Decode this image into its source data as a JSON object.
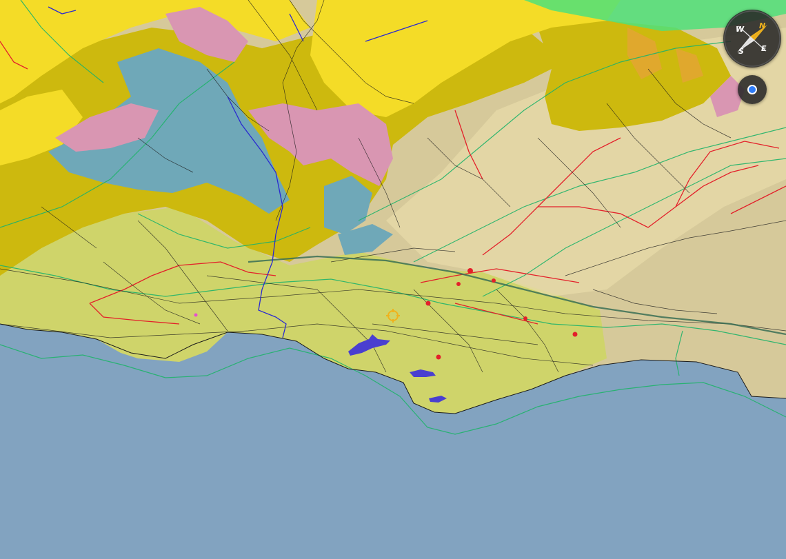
{
  "map": {
    "view": "3d-terrain",
    "layers": [
      "geologic-units",
      "faults",
      "roads",
      "contours",
      "water-bodies"
    ],
    "colors": {
      "ocean": "#82a3c0",
      "alluvium": "#cfd46a",
      "terrace": "#d6c99a",
      "sandstone": "#cdb90e",
      "shale": "#f4dc27",
      "volcanic": "#d996b2",
      "marine": "#6fa8b8",
      "fault": "#e3202a",
      "contour": "#1fb36a",
      "water": "#4a3fd0",
      "road": "#1a1a1a"
    }
  },
  "compass": {
    "north": "N",
    "south": "S",
    "east": "E",
    "west": "W",
    "needle_color": "#f0b21c"
  },
  "locate": {
    "icon": "my-location-icon",
    "dot_color": "#2f7cf6"
  },
  "crosshair": {
    "icon": "crosshair-icon",
    "color": "#f0b21c"
  }
}
